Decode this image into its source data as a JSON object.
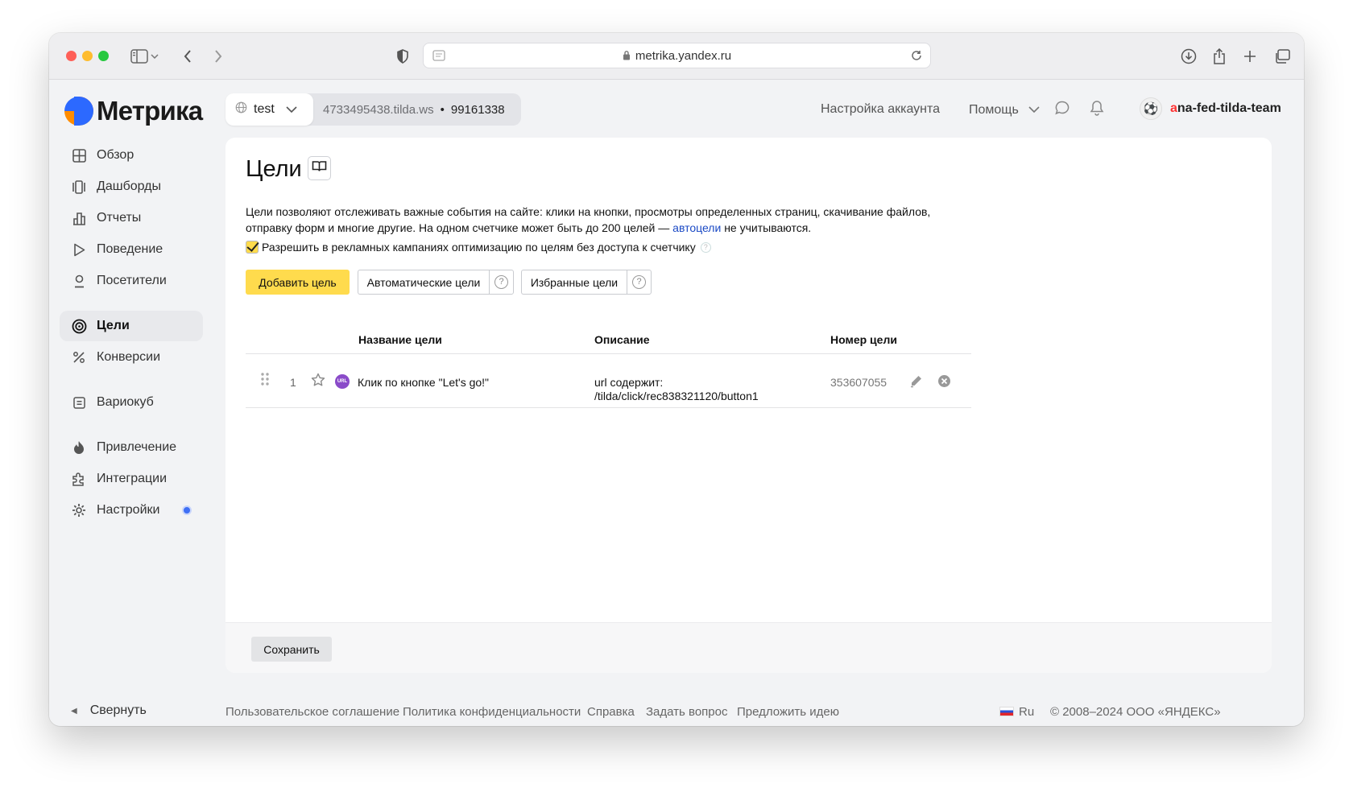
{
  "browser": {
    "url": "metrika.yandex.ru"
  },
  "header": {
    "logo": "Метрика",
    "counter_name": "test",
    "counter_site": "4733495438.tilda.ws",
    "counter_separator": "•",
    "counter_id": "99161338",
    "account_settings": "Настройка аккаунта",
    "help": "Помощь",
    "user_first_letter": "a",
    "user_rest": "na-fed-tilda-team"
  },
  "sidebar": {
    "items": [
      {
        "label": "Обзор",
        "icon": "grid-icon"
      },
      {
        "label": "Дашборды",
        "icon": "dashboards-icon"
      },
      {
        "label": "Отчеты",
        "icon": "reports-icon"
      },
      {
        "label": "Поведение",
        "icon": "play-icon"
      },
      {
        "label": "Посетители",
        "icon": "person-icon"
      },
      {
        "label": "Цели",
        "icon": "target-icon",
        "active": true
      },
      {
        "label": "Конверсии",
        "icon": "percent-icon"
      },
      {
        "label": "Вариокуб",
        "icon": "variocube-icon"
      },
      {
        "label": "Привлечение",
        "icon": "fire-icon"
      },
      {
        "label": "Интеграции",
        "icon": "puzzle-icon"
      },
      {
        "label": "Настройки",
        "icon": "gear-icon"
      }
    ],
    "collapse": "Свернуть"
  },
  "main": {
    "title": "Цели",
    "intro_part1": "Цели позволяют отслеживать важные события на сайте: клики на кнопки, просмотры определенных страниц, скачивание файлов, отправку форм и многие другие. На одном счетчике может быть до 200 целей — ",
    "intro_link": "автоцели",
    "intro_part2": " не учитываются.",
    "allow_checkbox": "Разрешить в рекламных кампаниях оптимизацию по целям без доступа к счетчику",
    "buttons": {
      "add": "Добавить цель",
      "auto": "Автоматические цели",
      "favorites": "Избранные цели"
    },
    "table": {
      "headers": [
        "Название цели",
        "Описание",
        "Номер цели"
      ],
      "rows": [
        {
          "index": "1",
          "type_badge": "URL",
          "name": "Клик по кнопке \"Let's go!\"",
          "desc_line1": "url содержит:",
          "desc_line2": "/tilda/click/rec838321120/button1",
          "number": "353607055"
        }
      ]
    },
    "save": "Сохранить"
  },
  "footer": {
    "links": [
      "Пользовательское соглашение",
      "Политика конфиденциальности",
      "Справка",
      "Задать вопрос",
      "Предложить идею"
    ],
    "lang": "Ru",
    "copyright": "© 2008–2024 ООО «ЯНДЕКС»"
  }
}
